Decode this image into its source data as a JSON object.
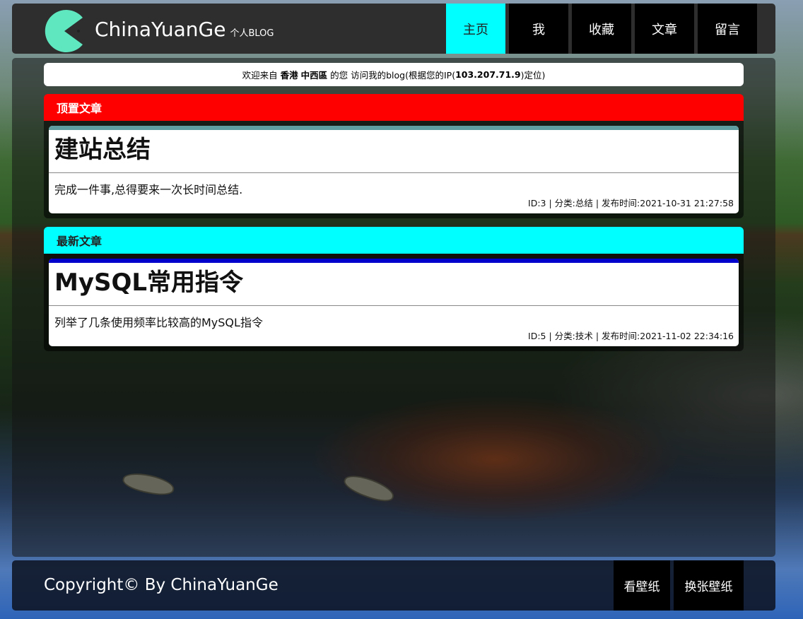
{
  "header": {
    "site_name": "ChinaYuanGe",
    "site_sub": "个人BLOG",
    "nav": [
      "主页",
      "我",
      "收藏",
      "文章",
      "留言"
    ],
    "active_nav": 0
  },
  "welcome": {
    "prefix": "欢迎来自",
    "region": "香港",
    "district": "中西區",
    "middle": "的您 访问我的blog(根据您的IP(",
    "ip": "103.207.71.9",
    "suffix": ")定位)"
  },
  "sections": [
    {
      "heading": "顶置文章",
      "head_color": "#ff0000",
      "head_text_color": "#ffffff",
      "accent_color": "#5f9ea0",
      "article": {
        "title": "建站总结",
        "summary": "完成一件事,总得要来一次长时间总结.",
        "meta": "ID:3 | 分类:总结 | 发布时间:2021-10-31 21:27:58"
      }
    },
    {
      "heading": "最新文章",
      "head_color": "#00ffff",
      "head_text_color": "#222222",
      "accent_color": "#0000cd",
      "article": {
        "title": "MySQL常用指令",
        "summary": "列举了几条使用频率比较高的MySQL指令",
        "meta": "ID:5 | 分类:技术 | 发布时间:2021-11-02 22:34:16"
      }
    }
  ],
  "footer": {
    "copyright": "Copyright© By ChinaYuanGe",
    "buttons": [
      "看壁纸",
      "换张壁纸"
    ]
  }
}
